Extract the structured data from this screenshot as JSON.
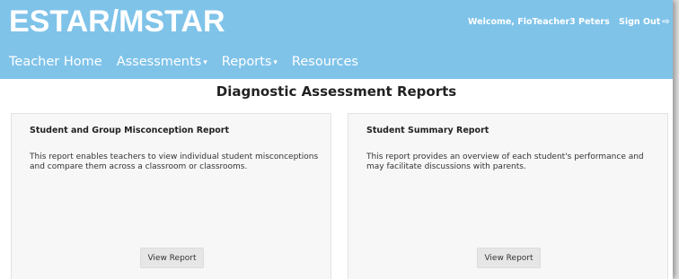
{
  "header": {
    "brand": "ESTAR/MSTAR",
    "welcome": "Welcome, FloTeacher3 Peters",
    "sign_out": "Sign Out",
    "sign_out_icon": "sign-out-icon"
  },
  "nav": {
    "items": [
      {
        "label": "Teacher Home"
      },
      {
        "label": "Assessments"
      },
      {
        "label": "Reports"
      },
      {
        "label": "Resources"
      }
    ],
    "caret": "▾"
  },
  "page": {
    "title": "Diagnostic Assessment Reports"
  },
  "panels": [
    {
      "title": "Student and Group Misconception Report",
      "description": "This report enables teachers to view individual student misconceptions and compare them across a classroom or classrooms.",
      "button": "View Report"
    },
    {
      "title": "Student Summary Report",
      "description": "This report provides an overview of each student's performance and may facilitate discussions with parents.",
      "button": "View Report"
    }
  ],
  "colors": {
    "header_bg": "#7fc3e9",
    "header_text": "#ffffff",
    "panel_bg": "#f7f7f7",
    "button_bg": "#e6e6e6"
  }
}
